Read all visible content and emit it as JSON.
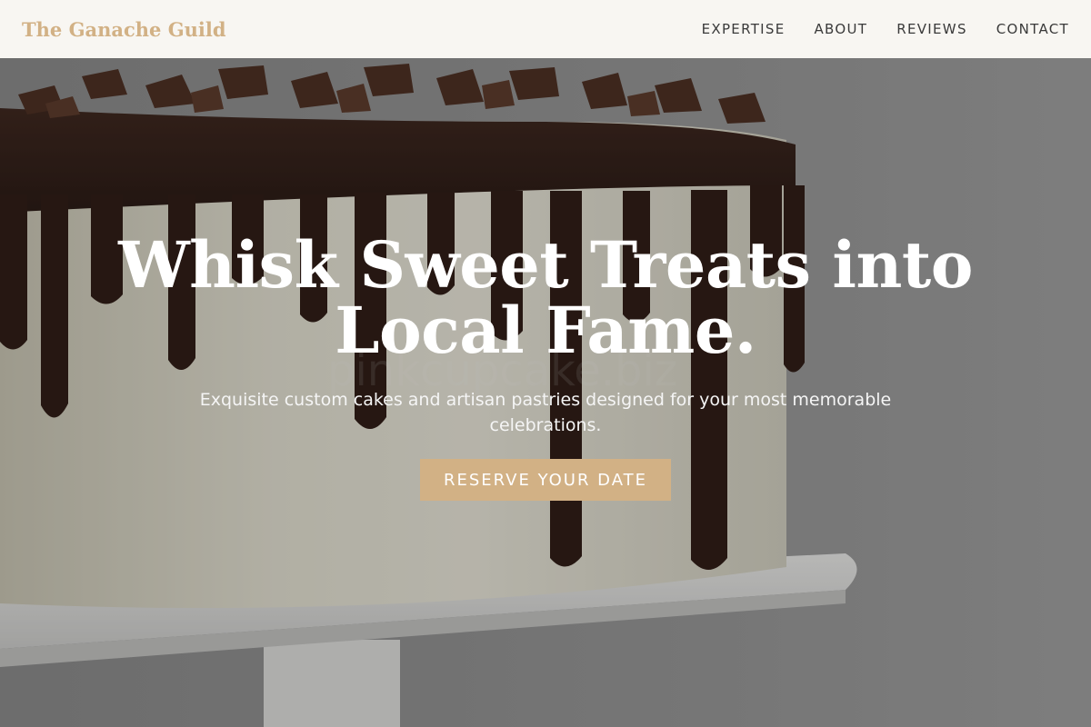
{
  "header": {
    "brand": "The Ganache Guild",
    "nav": [
      {
        "label": "EXPERTISE"
      },
      {
        "label": "ABOUT"
      },
      {
        "label": "REVIEWS"
      },
      {
        "label": "CONTACT"
      }
    ]
  },
  "hero": {
    "title": "Whisk Sweet Treats into Local Fame.",
    "subtitle": "Exquisite custom cakes and artisan pastries designed for your most memorable celebrations.",
    "cta_label": "RESERVE YOUR DATE",
    "image_subject": "chocolate-drip-cake-photo",
    "watermark": "pinkcupcake.biz"
  },
  "colors": {
    "accent": "#d2b185",
    "header_bg": "#f8f6f2",
    "nav_text": "#3a3a3a",
    "hero_text": "#ffffff"
  }
}
